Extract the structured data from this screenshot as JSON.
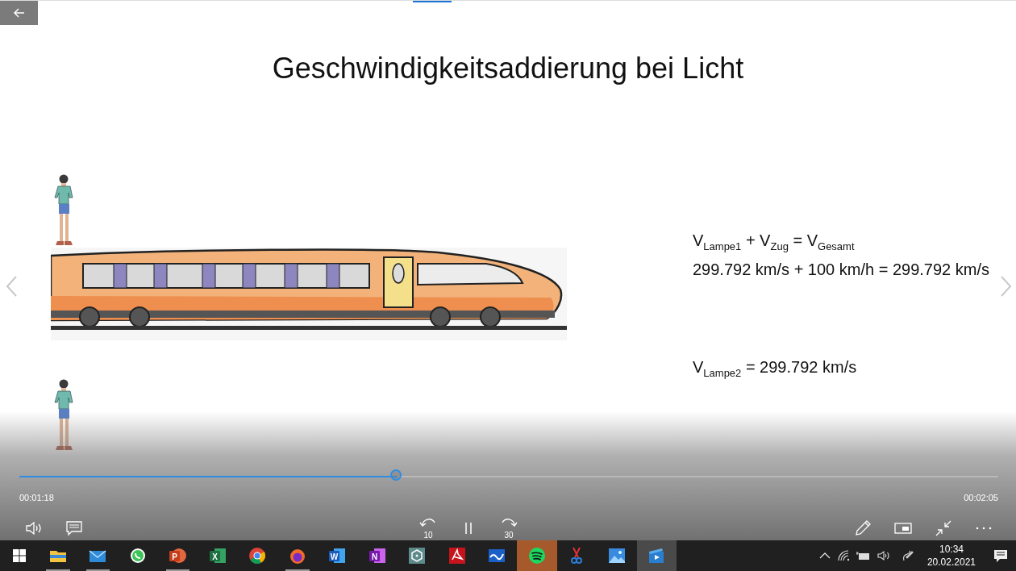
{
  "slide": {
    "title": "Geschwindigkeitsaddierung bei Licht",
    "formula_blocks": [
      [
        "V$_{Lampe1}$ + V$_{Zug}$ = V$_{Gesamt}$",
        "299.792 km/s + 100 km/h = 299.792 km/s"
      ],
      [
        "V$_{Lampe2}$ = 299.792 km/s"
      ]
    ]
  },
  "playback": {
    "elapsed": "00:01:18",
    "duration": "00:02:05",
    "level": 0.386,
    "playing": true,
    "rewind_label": "10",
    "forward_label": "30"
  },
  "taskbar": {
    "apps": [
      {
        "kind": "folder",
        "running": true,
        "active": false,
        "attention": false
      },
      {
        "kind": "mail",
        "running": true,
        "active": false,
        "attention": false
      },
      {
        "kind": "chat",
        "running": false,
        "active": false,
        "attention": false
      },
      {
        "kind": "slides",
        "letter": "P",
        "running": true,
        "active": false,
        "attention": false
      },
      {
        "kind": "sheet",
        "letter": "X",
        "running": false,
        "active": false,
        "attention": false
      },
      {
        "kind": "browser",
        "running": false,
        "active": false,
        "attention": false
      },
      {
        "kind": "fox",
        "running": true,
        "active": false,
        "attention": false
      },
      {
        "kind": "doc",
        "letter": "W",
        "running": false,
        "active": false,
        "attention": false
      },
      {
        "kind": "notes",
        "letter": "N",
        "running": false,
        "active": false,
        "attention": false
      },
      {
        "kind": "hex",
        "running": false,
        "active": false,
        "attention": false
      },
      {
        "kind": "pdf",
        "running": false,
        "active": false,
        "attention": false
      },
      {
        "kind": "wave",
        "running": false,
        "active": false,
        "attention": false
      },
      {
        "kind": "music",
        "running": false,
        "active": false,
        "attention": true
      },
      {
        "kind": "scissors",
        "running": false,
        "active": false,
        "attention": false
      },
      {
        "kind": "picture",
        "running": false,
        "active": false,
        "attention": false
      },
      {
        "kind": "video",
        "running": false,
        "active": true,
        "attention": false
      }
    ],
    "clock": {
      "time": "10:34",
      "date": "20.02.2021"
    }
  }
}
